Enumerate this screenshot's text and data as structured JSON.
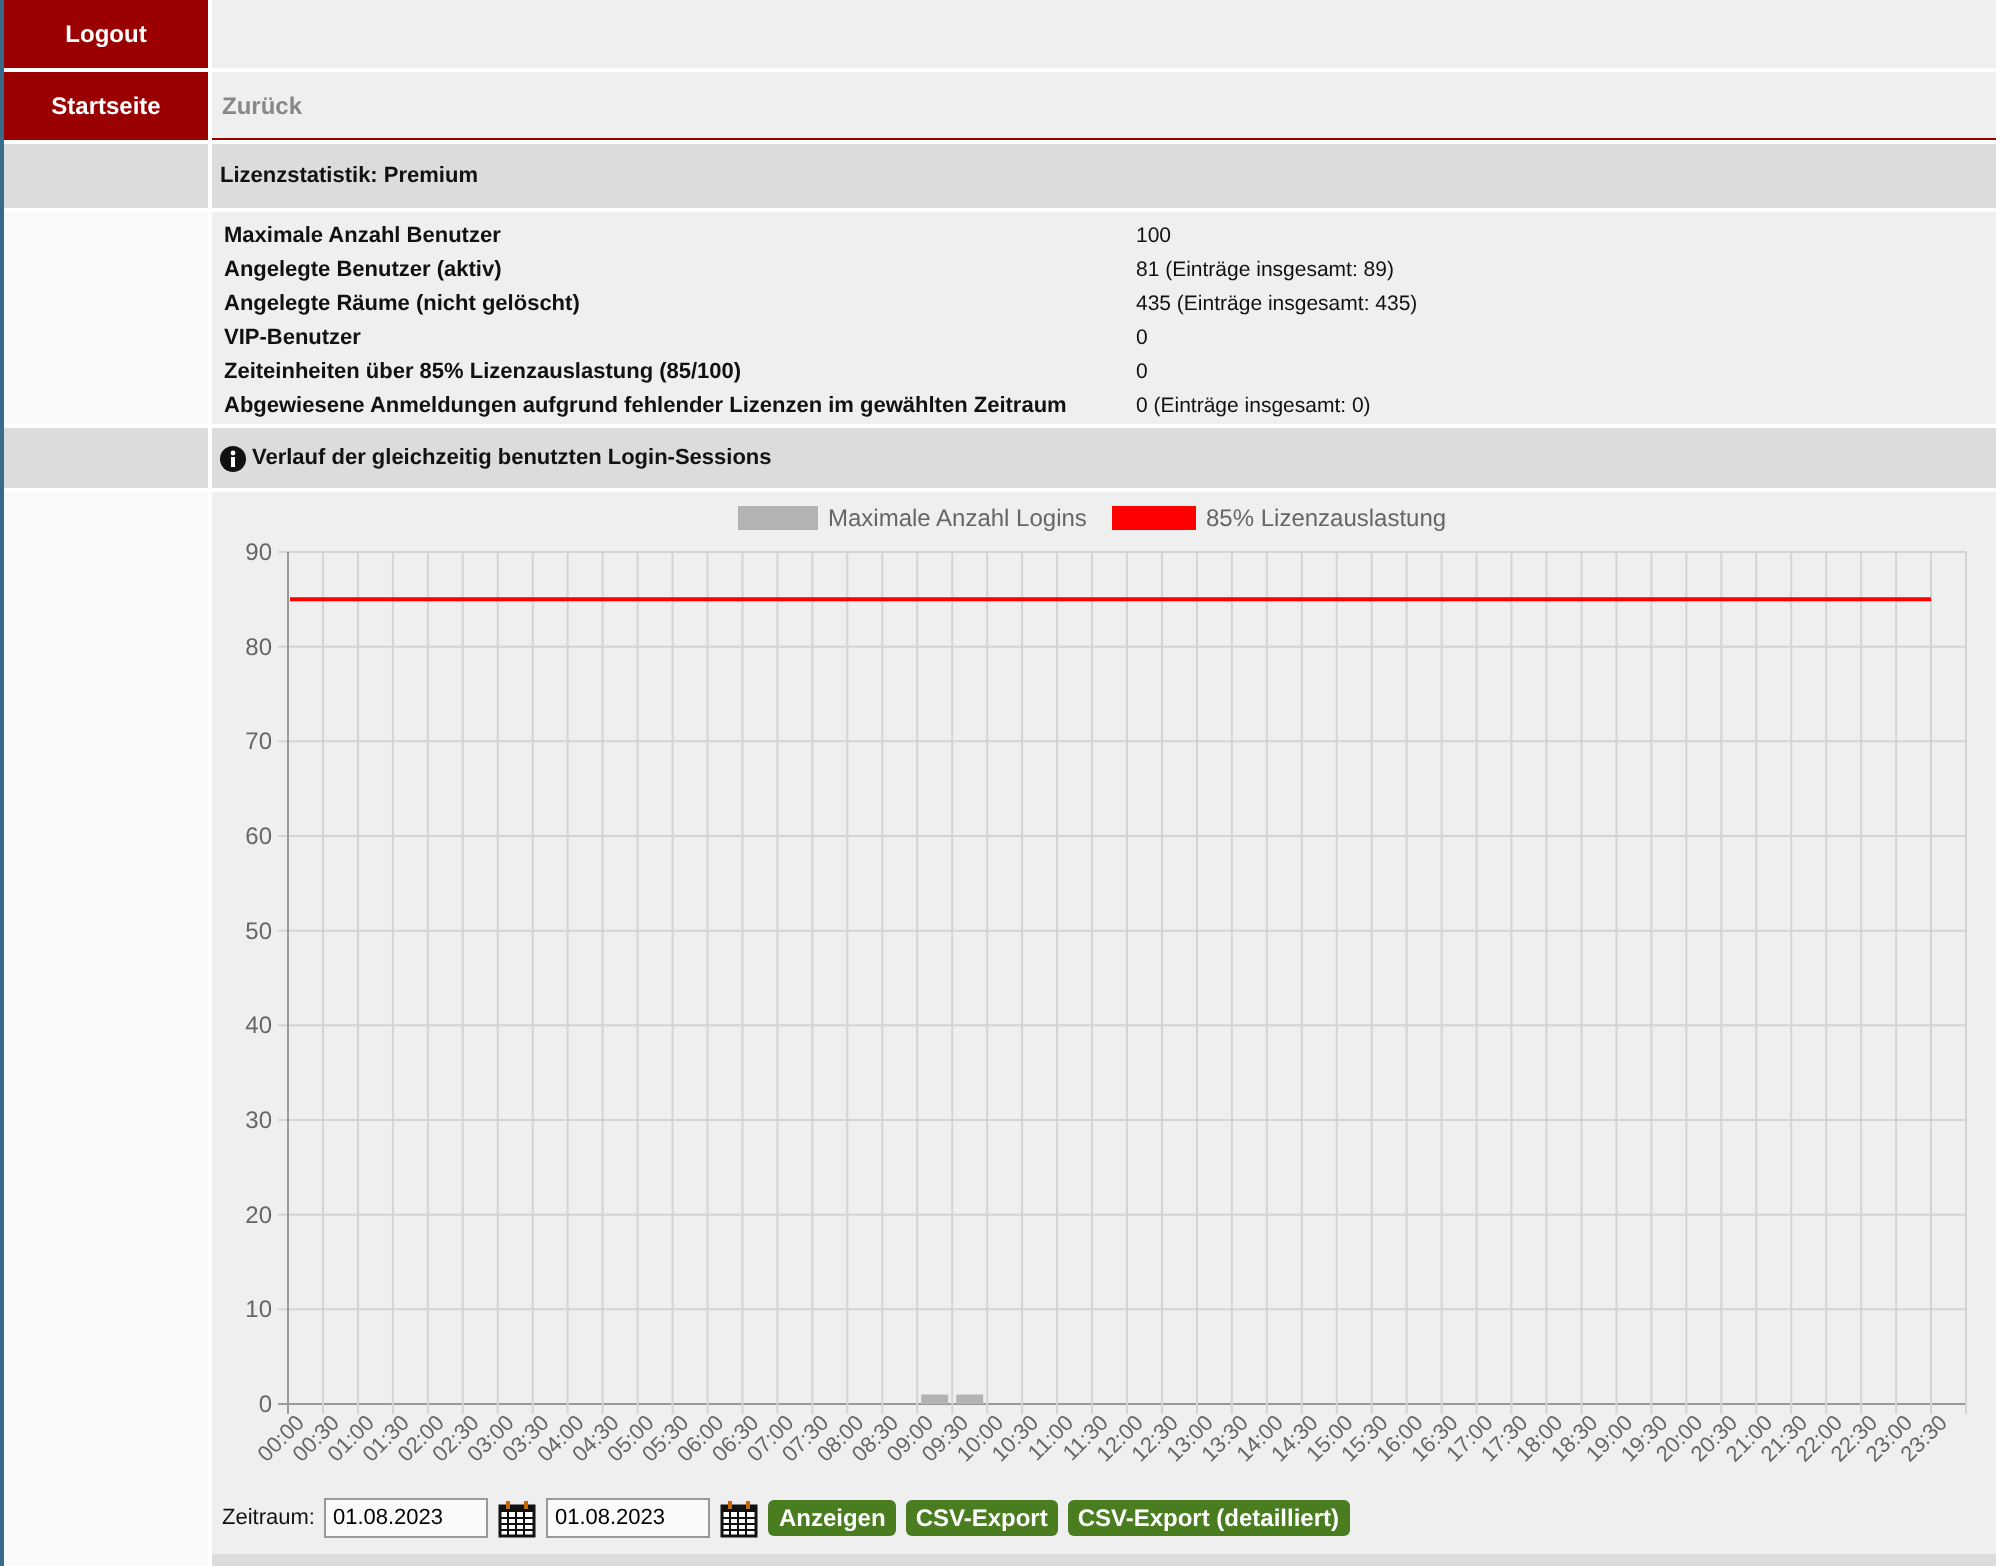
{
  "nav": [
    {
      "label": "Logout"
    },
    {
      "label": "Startseite"
    }
  ],
  "back_link": "Zurück",
  "stats": {
    "title": "Lizenzstatistik: Premium",
    "rows": [
      {
        "label": "Maximale Anzahl Benutzer",
        "value": "100"
      },
      {
        "label": "Angelegte Benutzer (aktiv)",
        "value": "81 (Einträge insgesamt: 89)"
      },
      {
        "label": "Angelegte Räume (nicht gelöscht)",
        "value": "435 (Einträge insgesamt: 435)"
      },
      {
        "label": "VIP-Benutzer",
        "value": "0"
      },
      {
        "label": "Zeiteinheiten über 85% Lizenzauslastung (85/100)",
        "value": "0"
      },
      {
        "label": "Abgewiesene Anmeldungen aufgrund fehlender Lizenzen im gewählten Zeitraum",
        "value": "0 (Einträge insgesamt: 0)"
      }
    ]
  },
  "sessions": {
    "title": "Verlauf der gleichzeitig benutzten Login-Sessions",
    "chart_data": {
      "type": "bar",
      "categories": [
        "00:00",
        "00:30",
        "01:00",
        "01:30",
        "02:00",
        "02:30",
        "03:00",
        "03:30",
        "04:00",
        "04:30",
        "05:00",
        "05:30",
        "06:00",
        "06:30",
        "07:00",
        "07:30",
        "08:00",
        "08:30",
        "09:00",
        "09:30",
        "10:00",
        "10:30",
        "11:00",
        "11:30",
        "12:00",
        "12:30",
        "13:00",
        "13:30",
        "14:00",
        "14:30",
        "15:00",
        "15:30",
        "16:00",
        "16:30",
        "17:00",
        "17:30",
        "18:00",
        "18:30",
        "19:00",
        "19:30",
        "20:00",
        "20:30",
        "21:00",
        "21:30",
        "22:00",
        "22:30",
        "23:00",
        "23:30"
      ],
      "grid": true,
      "legend": true,
      "ylim": [
        0,
        90
      ],
      "yticks": [
        0,
        10,
        20,
        30,
        40,
        50,
        60,
        70,
        80,
        90
      ],
      "series": [
        {
          "name": "Maximale Anzahl Logins",
          "color": "#b3b3b3",
          "values": [
            0,
            0,
            0,
            0,
            0,
            0,
            0,
            0,
            0,
            0,
            0,
            0,
            0,
            0,
            0,
            0,
            0,
            0,
            1,
            1,
            0,
            0,
            0,
            0,
            0,
            0,
            0,
            0,
            0,
            0,
            0,
            0,
            0,
            0,
            0,
            0,
            0,
            0,
            0,
            0,
            0,
            0,
            0,
            0,
            0,
            0,
            0,
            0
          ]
        },
        {
          "name": "85% Lizenzauslastung",
          "color": "#ff0000",
          "type": "line",
          "values": [
            85,
            85,
            85,
            85,
            85,
            85,
            85,
            85,
            85,
            85,
            85,
            85,
            85,
            85,
            85,
            85,
            85,
            85,
            85,
            85,
            85,
            85,
            85,
            85,
            85,
            85,
            85,
            85,
            85,
            85,
            85,
            85,
            85,
            85,
            85,
            85,
            85,
            85,
            85,
            85,
            85,
            85,
            85,
            85,
            85,
            85,
            85,
            85
          ]
        }
      ]
    },
    "range_label": "Zeitraum:",
    "date_from": "01.08.2023",
    "date_to": "01.08.2023",
    "buttons": [
      "Anzeigen",
      "CSV-Export",
      "CSV-Export (detailliert)"
    ]
  }
}
